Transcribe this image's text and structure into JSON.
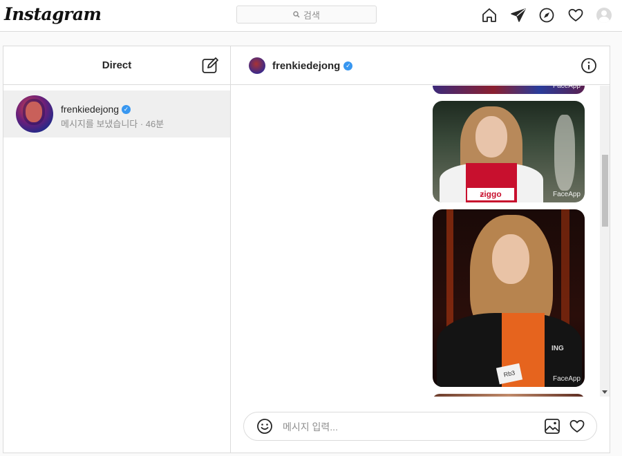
{
  "app": {
    "logo": "Instagram"
  },
  "search": {
    "placeholder": "검색"
  },
  "nav": {
    "icons": [
      "home-icon",
      "direct-icon",
      "explore-icon",
      "activity-heart-icon",
      "profile-avatar"
    ]
  },
  "inbox": {
    "title": "Direct",
    "threads": [
      {
        "username": "frenkiedejong",
        "verified": true,
        "preview": "메시지를 보냈습니다 · 46분"
      }
    ]
  },
  "chat": {
    "username": "frenkiedejong",
    "verified": true,
    "watermark": "FaceApp",
    "photos": [
      "photo-partial-top",
      "photo-ajax-shirt",
      "photo-netherlands-jacket",
      "photo-partial-bottom"
    ],
    "badge_text": "Rb3",
    "jacket_text": "ING"
  },
  "composer": {
    "placeholder": "메시지 입력..."
  },
  "colors": {
    "accent": "#3897f0",
    "border": "#dbdbdb",
    "muted": "#8e8e8e",
    "selected_thread": "#efefef"
  }
}
